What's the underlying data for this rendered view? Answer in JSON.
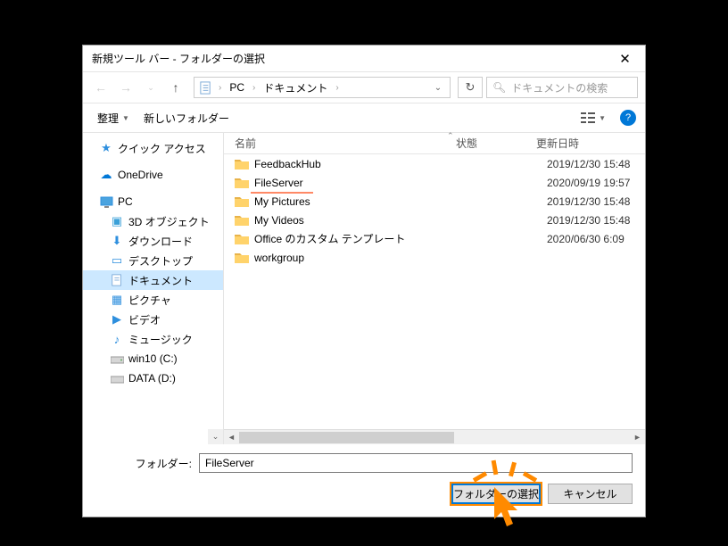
{
  "title": "新規ツール バー - フォルダーの選択",
  "breadcrumb": {
    "root": "PC",
    "folder": "ドキュメント"
  },
  "search": {
    "placeholder": "ドキュメントの検索"
  },
  "toolbar": {
    "organize": "整理",
    "new_folder": "新しいフォルダー"
  },
  "columns": {
    "name": "名前",
    "status": "状態",
    "date": "更新日時"
  },
  "nav": {
    "quick_access": "クイック アクセス",
    "onedrive": "OneDrive",
    "pc": "PC",
    "sub": {
      "objects3d": "3D オブジェクト",
      "downloads": "ダウンロード",
      "desktop": "デスクトップ",
      "documents": "ドキュメント",
      "pictures": "ピクチャ",
      "videos": "ビデオ",
      "music": "ミュージック",
      "cdrive": "win10 (C:)",
      "ddrive": "DATA (D:)"
    }
  },
  "files": [
    {
      "name": "FeedbackHub",
      "date": "2019/12/30 15:48"
    },
    {
      "name": "FileServer",
      "date": "2020/09/19 19:57"
    },
    {
      "name": "My Pictures",
      "date": "2019/12/30 15:48"
    },
    {
      "name": "My Videos",
      "date": "2019/12/30 15:48"
    },
    {
      "name": "Office のカスタム テンプレート",
      "date": "2020/06/30 6:09"
    },
    {
      "name": "workgroup",
      "date": ""
    }
  ],
  "footer": {
    "field_label": "フォルダー:",
    "field_value": "FileServer",
    "select": "フォルダーの選択",
    "cancel": "キャンセル"
  }
}
